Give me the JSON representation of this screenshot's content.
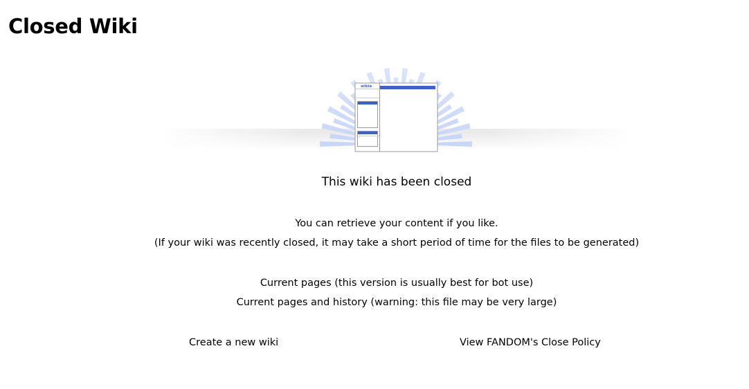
{
  "header": {
    "title": "Closed Wiki"
  },
  "illustration": {
    "logo_text": "wikia",
    "accent_color": "#3d62c4",
    "ray_color": "#c9d6f7"
  },
  "main": {
    "closed_message": "This wiki has been closed",
    "retrieve_text": "You can retrieve your content if you like.",
    "retrieve_note": "(If your wiki was recently closed, it may take a short period of time for the files to be generated)",
    "dump_current": "Current pages (this version is usually best for bot use)",
    "dump_history": "Current pages and history (warning: this file may be very large)"
  },
  "footer": {
    "create_wiki": "Create a new wiki",
    "close_policy": "View FANDOM's Close Policy"
  }
}
